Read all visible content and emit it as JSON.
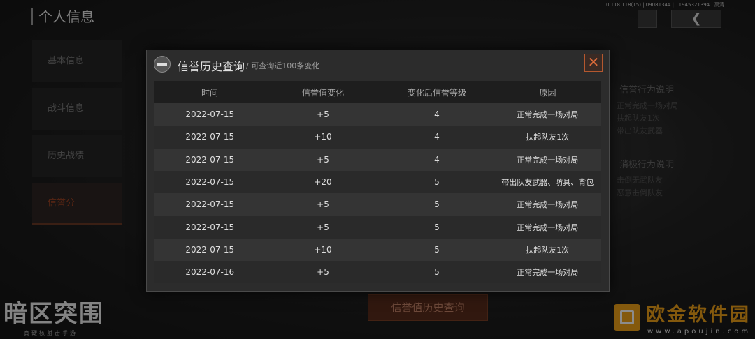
{
  "version": "1.0.118.118(15) | 09081344 | 11945321394 | 高清",
  "page": {
    "title": "个人信息"
  },
  "sidebar": {
    "items": [
      {
        "label": "基本信息"
      },
      {
        "label": "战斗信息"
      },
      {
        "label": "历史战绩"
      },
      {
        "label": "信誉分"
      }
    ]
  },
  "right_panel": {
    "positive_title": "信誉行为说明",
    "positive_items": [
      "正常完成一场对局",
      "扶起队友1次",
      "带出队友武器"
    ],
    "negative_title": "消极行为说明",
    "negative_items": [
      "击倒无武队友",
      "恶意击倒队友"
    ]
  },
  "bottom_button": "信誉值历史查询",
  "logo": {
    "title": "暗区突围",
    "subtitle": "真硬核射击手游"
  },
  "watermark": {
    "text": "欧金软件园",
    "url": "www.apoujin.com"
  },
  "modal": {
    "title": "信誉历史查询",
    "subtitle": "/ 可查询近100条变化",
    "close_label": "✕",
    "columns": [
      "时间",
      "信誉值变化",
      "变化后信誉等级",
      "原因"
    ],
    "rows": [
      [
        "2022-07-15",
        "+5",
        "4",
        "正常完成一场对局"
      ],
      [
        "2022-07-15",
        "+10",
        "4",
        "扶起队友1次"
      ],
      [
        "2022-07-15",
        "+5",
        "4",
        "正常完成一场对局"
      ],
      [
        "2022-07-15",
        "+20",
        "5",
        "带出队友武器、防具、背包"
      ],
      [
        "2022-07-15",
        "+5",
        "5",
        "正常完成一场对局"
      ],
      [
        "2022-07-15",
        "+5",
        "5",
        "正常完成一场对局"
      ],
      [
        "2022-07-15",
        "+10",
        "5",
        "扶起队友1次"
      ],
      [
        "2022-07-16",
        "+5",
        "5",
        "正常完成一场对局"
      ]
    ]
  }
}
